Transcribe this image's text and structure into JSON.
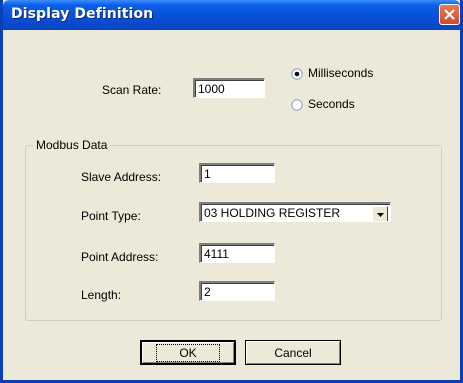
{
  "window": {
    "title": "Display Definition"
  },
  "scan": {
    "label": "Scan Rate:",
    "value": "1000",
    "units": [
      {
        "label": "Milliseconds",
        "selected": true
      },
      {
        "label": "Seconds",
        "selected": false
      }
    ]
  },
  "modbus": {
    "legend": "Modbus Data",
    "slave_address": {
      "label": "Slave Address:",
      "value": "1"
    },
    "point_type": {
      "label": "Point Type:",
      "value": "03 HOLDING REGISTER"
    },
    "point_address": {
      "label": "Point Address:",
      "value": "4111"
    },
    "length": {
      "label": "Length:",
      "value": "2"
    }
  },
  "buttons": {
    "ok": "OK",
    "cancel": "Cancel"
  },
  "icons": {
    "close": "close-icon",
    "dropdown": "dropdown-arrow-icon",
    "radio_selected": "radio-selected-icon",
    "radio_unselected": "radio-unselected-icon"
  },
  "colors": {
    "titlebar": "#0A4ED6",
    "close_button": "#D4482A",
    "dialog_face": "#ECE9D8"
  }
}
